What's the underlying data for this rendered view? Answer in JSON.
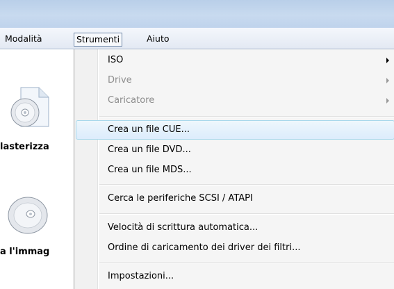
{
  "menubar": {
    "items": [
      {
        "label": "Modalità"
      },
      {
        "label": "Strumenti"
      },
      {
        "label": "Aiuto"
      }
    ]
  },
  "left_panel": {
    "labels": [
      "lasterizza",
      "a l'immag"
    ],
    "icons": [
      "disc-icon",
      "disc-icon"
    ]
  },
  "dropdown": {
    "items": [
      {
        "label": "ISO",
        "enabled": true,
        "submenu": true
      },
      {
        "label": "Drive",
        "enabled": false,
        "submenu": true
      },
      {
        "label": "Caricatore",
        "enabled": false,
        "submenu": true
      },
      {
        "label": "Crea un file CUE...",
        "enabled": true,
        "highlighted": true
      },
      {
        "label": "Crea un file DVD...",
        "enabled": true
      },
      {
        "label": "Crea un file MDS...",
        "enabled": true
      },
      {
        "label": "Cerca le periferiche SCSI / ATAPI",
        "enabled": true
      },
      {
        "label": "Velocità di scrittura automatica...",
        "enabled": true
      },
      {
        "label": "Ordine di caricamento dei driver dei filtri...",
        "enabled": true
      },
      {
        "label": "Impostazioni...",
        "enabled": true
      }
    ]
  },
  "colors": {
    "highlight_border": "#a8d8eb",
    "disabled_text": "#8d8d8d"
  }
}
